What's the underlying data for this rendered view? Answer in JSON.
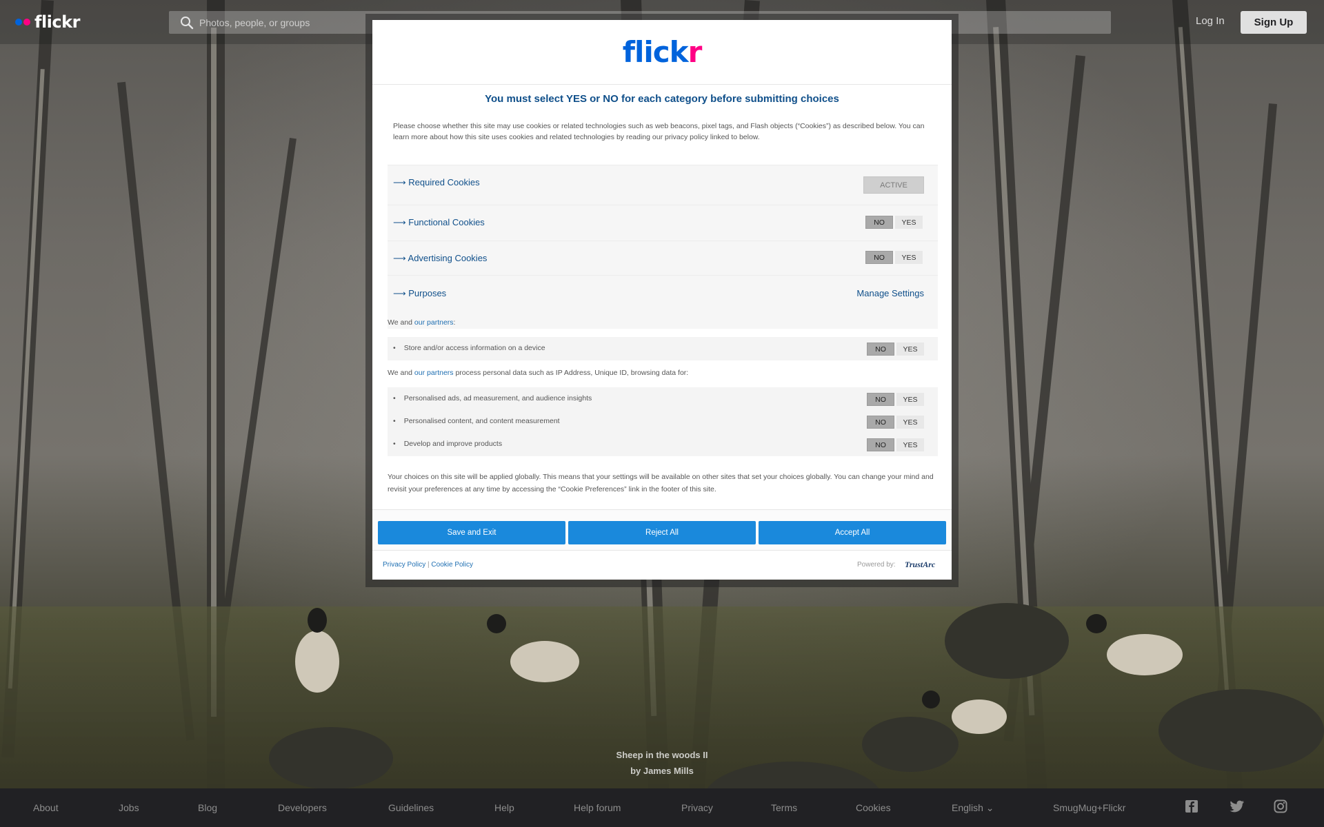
{
  "topbar": {
    "logo_text": "flickr",
    "search_placeholder": "Photos, people, or groups",
    "login_label": "Log In",
    "signup_label": "Sign Up"
  },
  "photo": {
    "title": "Sheep in the woods II",
    "byline": "by James Mills"
  },
  "modal": {
    "logo_blue": "flick",
    "logo_pink": "r",
    "heading": "You must select YES or NO for each category before submitting choices",
    "intro": "Please choose whether this site may use cookies or related technologies such as web beacons, pixel tags, and Flash objects (“Cookies”) as described below. You can learn more about how this site uses cookies and related technologies by reading our privacy policy linked to below.",
    "categories": [
      {
        "label": "⟶ Required Cookies",
        "state": "ACTIVE"
      },
      {
        "label": "⟶ Functional Cookies",
        "no": "NO",
        "yes": "YES"
      },
      {
        "label": "⟶ Advertising Cookies",
        "no": "NO",
        "yes": "YES"
      },
      {
        "label": "⟶ Purposes",
        "action": "Manage Settings"
      }
    ],
    "we_and": "We and ",
    "partners_link": "our partners",
    "we_colon": ":",
    "process_text": " process personal data such as IP Address, Unique ID, browsing data for:",
    "storage_items": [
      {
        "label": "Store and/or access information on a device",
        "no": "NO",
        "yes": "YES"
      }
    ],
    "purpose_items": [
      {
        "label": "Personalised ads, ad measurement, and audience insights",
        "no": "NO",
        "yes": "YES"
      },
      {
        "label": "Personalised content, and content measurement",
        "no": "NO",
        "yes": "YES"
      },
      {
        "label": "Develop and improve products",
        "no": "NO",
        "yes": "YES"
      }
    ],
    "globally_text": "Your choices on this site will be applied globally. This means that your settings will be available on other sites that set your choices globally. You can change your mind and revisit your preferences at any time by accessing the “Cookie Preferences” link in the footer of this site.",
    "buttons": {
      "save": "Save and Exit",
      "reject": "Reject All",
      "accept": "Accept All"
    },
    "footer": {
      "privacy": "Privacy Policy",
      "separator": " | ",
      "cookie": "Cookie Policy",
      "powered": "Powered by:",
      "trustarc": "TrustArc"
    }
  },
  "footer": {
    "links": [
      "About",
      "Jobs",
      "Blog",
      "Developers",
      "Guidelines",
      "Help",
      "Help forum",
      "Privacy",
      "Terms",
      "Cookies",
      "English ⌄",
      "SmugMug+Flickr"
    ],
    "social": [
      "facebook-icon",
      "twitter-icon",
      "instagram-icon"
    ]
  }
}
